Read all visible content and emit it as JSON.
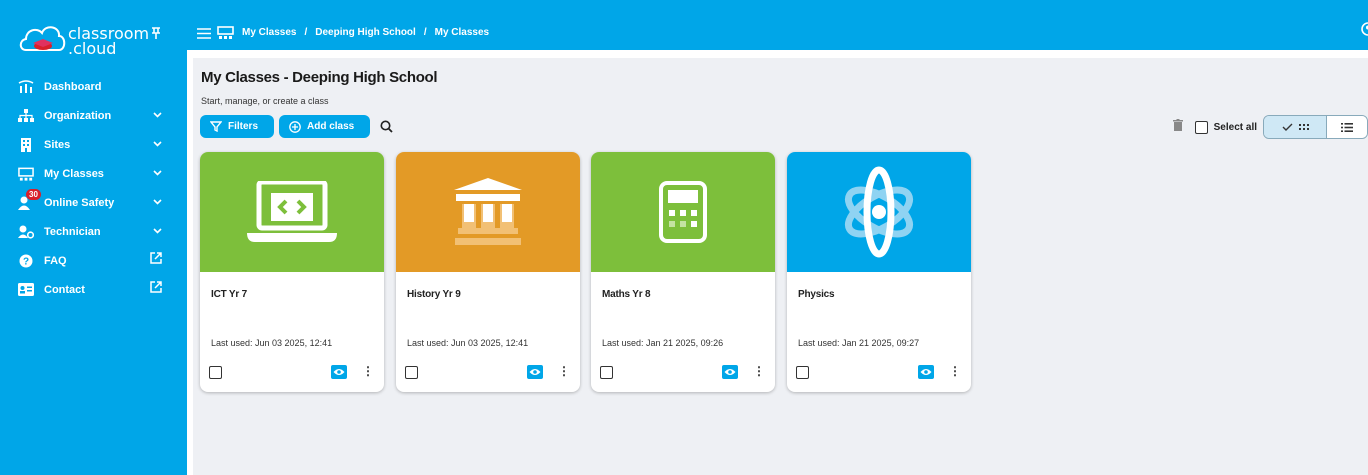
{
  "app": {
    "logo_line1": "classroom",
    "logo_line2": ".cloud",
    "brand_color": "#00a6e8"
  },
  "sidebar": {
    "items": [
      {
        "label": "Dashboard",
        "icon": "dashboard-icon",
        "has_chevron": false
      },
      {
        "label": "Organization",
        "icon": "org-chart-icon",
        "has_chevron": true
      },
      {
        "label": "Sites",
        "icon": "building-icon",
        "has_chevron": true
      },
      {
        "label": "My Classes",
        "icon": "classroom-icon",
        "has_chevron": true
      },
      {
        "label": "Online Safety",
        "icon": "online-safety-icon",
        "has_chevron": true,
        "badge": "30"
      },
      {
        "label": "Technician",
        "icon": "technician-icon",
        "has_chevron": true
      },
      {
        "label": "FAQ",
        "icon": "help-icon",
        "external": true
      },
      {
        "label": "Contact",
        "icon": "contact-card-icon",
        "external": true
      }
    ]
  },
  "breadcrumb": {
    "items": [
      "My Classes",
      "/",
      "Deeping High School",
      "/",
      "My Classes"
    ]
  },
  "page": {
    "title": "My Classes - Deeping High School",
    "subtitle": "Start, manage, or create a class"
  },
  "toolbar": {
    "filters_label": "Filters",
    "add_class_label": "Add class",
    "select_all_label": "Select all"
  },
  "classes": [
    {
      "name": "ICT Yr 7",
      "last_used": "Last used: Jun 03 2025, 12:41",
      "color": "#7dbf3b",
      "icon": "laptop-code-icon"
    },
    {
      "name": "History Yr 9",
      "last_used": "Last used: Jun 03 2025, 12:41",
      "color": "#e39a26",
      "icon": "museum-icon"
    },
    {
      "name": "Maths Yr 8",
      "last_used": "Last used: Jan 21 2025, 09:26",
      "color": "#7dbf3b",
      "icon": "calculator-icon"
    },
    {
      "name": "Physics",
      "last_used": "Last used: Jan 21 2025, 09:27",
      "color": "#00a6e8",
      "icon": "atom-icon"
    }
  ]
}
